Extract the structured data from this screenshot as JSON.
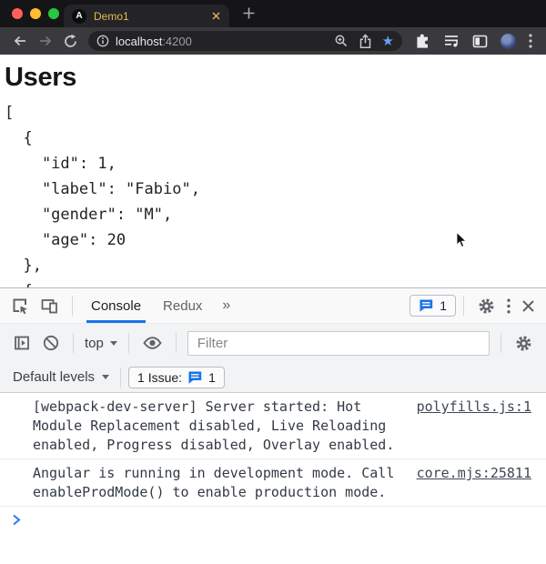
{
  "browser": {
    "traffic_lights": [
      "#ff5f57",
      "#febc2e",
      "#28c840"
    ],
    "tab": {
      "title": "Demo1",
      "favicon_letter": "A"
    },
    "address": {
      "host": "localhost",
      "port": ":4200"
    }
  },
  "page": {
    "heading": "Users",
    "body": "[\n  {\n    \"id\": 1,\n    \"label\": \"Fabio\",\n    \"gender\": \"M\",\n    \"age\": 20\n  },\n  {"
  },
  "devtools": {
    "tabs": {
      "console": "Console",
      "redux": "Redux",
      "more": "»"
    },
    "message_badge_count": "1",
    "context_selector": "top",
    "filter_placeholder": "Filter",
    "levels_selector": "Default levels",
    "issues": {
      "label": "1 Issue:",
      "count": "1"
    },
    "messages": [
      {
        "text": "[webpack-dev-server] Server started: Hot Module Replacement disabled, Live Reloading enabled, Progress disabled, Overlay enabled.",
        "source": "polyfills.js:1"
      },
      {
        "text": "Angular is running in development mode. Call enableProdMode() to enable production mode.",
        "source": "core.mjs:25811"
      }
    ]
  },
  "colors": {
    "accent_blue": "#1a73e8",
    "bookmark_star_blue": "#669df6",
    "tab_text_yellow": "#e5b94e",
    "console_link_slate": "#3e4654"
  }
}
